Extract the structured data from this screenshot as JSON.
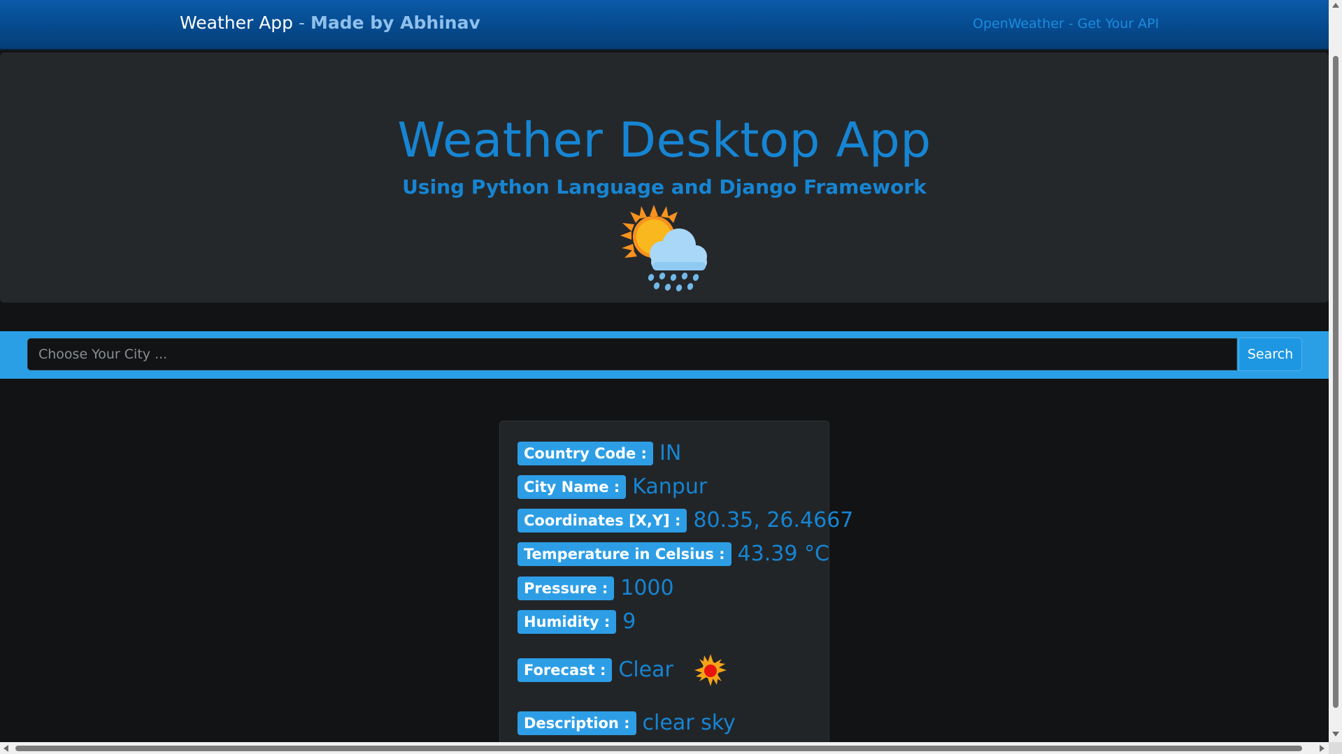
{
  "navbar": {
    "brand_name": "Weather App",
    "brand_separator": " - ",
    "brand_author": "Made by Abhinav",
    "link_label": "OpenWeather - Get Your API"
  },
  "hero": {
    "title": "Weather Desktop App",
    "subtitle": "Using Python Language and Django Framework",
    "icon": "sun-behind-rain-cloud-icon"
  },
  "search": {
    "placeholder": "Choose Your City ...",
    "value": "",
    "button_label": "Search"
  },
  "result": {
    "country_code": {
      "label": "Country Code :",
      "value": "IN"
    },
    "city_name": {
      "label": "City Name :",
      "value": "Kanpur"
    },
    "coordinates": {
      "label": "Coordinates [X,Y] :",
      "value": "80.35, 26.4667"
    },
    "temperature": {
      "label": "Temperature in Celsius :",
      "value": "43.39 °C"
    },
    "pressure": {
      "label": "Pressure :",
      "value": "1000"
    },
    "humidity": {
      "label": "Humidity :",
      "value": "9"
    },
    "forecast": {
      "label": "Forecast :",
      "value": "Clear",
      "icon": "sun-icon"
    },
    "description": {
      "label": "Description :",
      "value": "clear sky"
    }
  },
  "colors": {
    "accent": "#1685d3",
    "badge": "#2d9ee6",
    "navbar": "#064a8e",
    "search_band": "#2a9fe6",
    "background": "#121314",
    "panel": "#25282b"
  }
}
